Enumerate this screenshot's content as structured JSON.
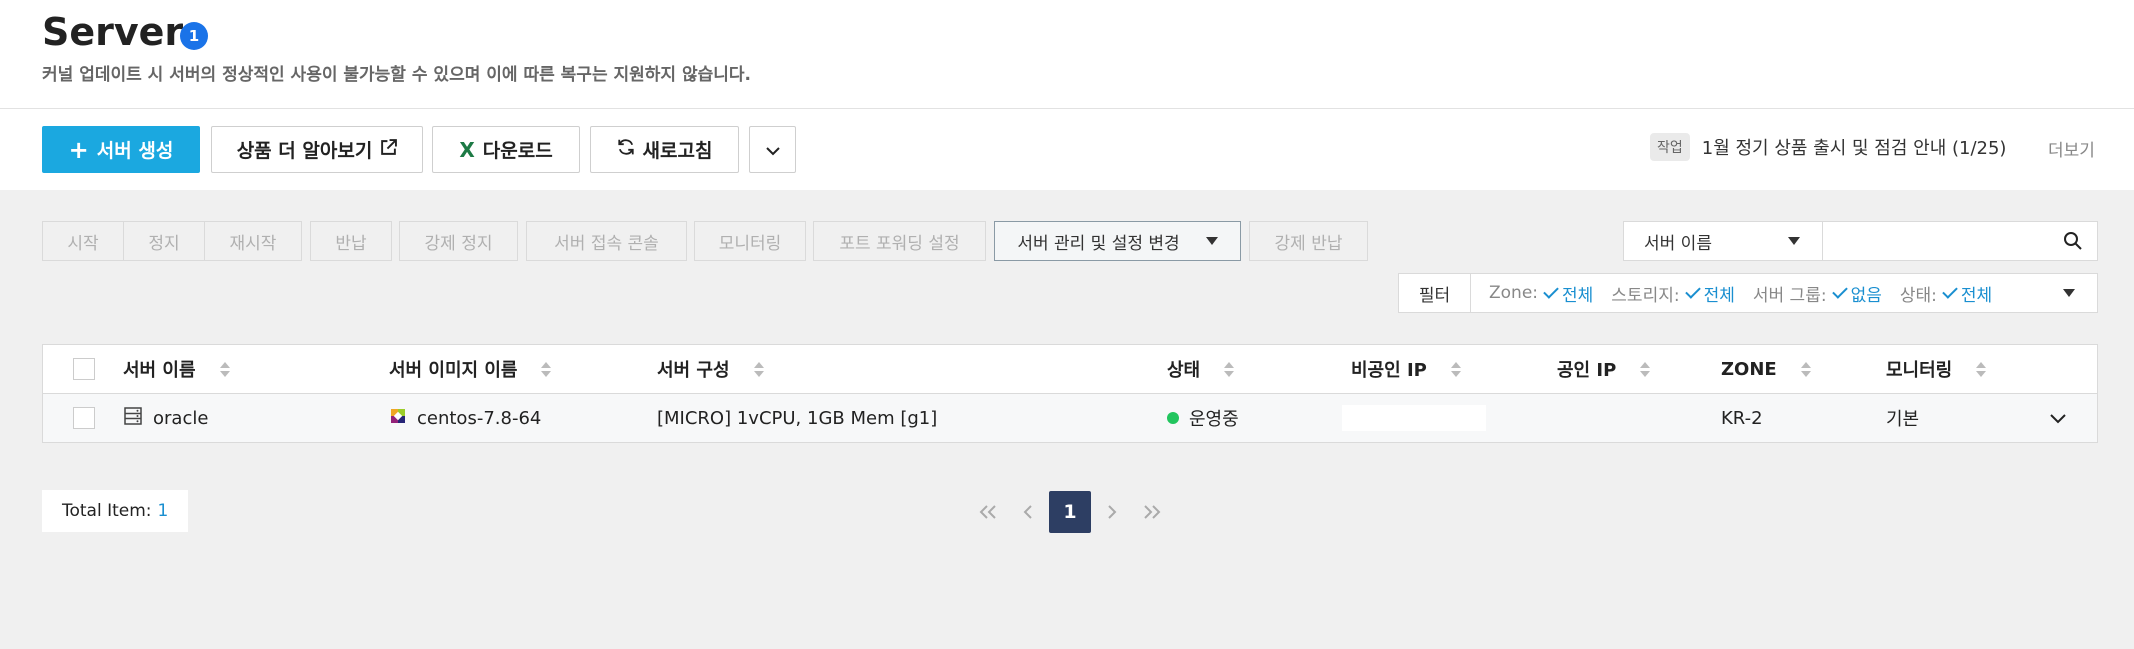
{
  "header": {
    "title": "Server",
    "count": "1",
    "subtitle": "커널 업데이트 시 서버의 정상적인 사용이 불가능할 수 있으며 이에 따른 복구는 지원하지 않습니다."
  },
  "toolbar": {
    "create": "서버 생성",
    "learn_more": "상품 더 알아보기",
    "download": "다운로드",
    "refresh": "새로고침"
  },
  "notice": {
    "tag": "작업",
    "text": "1월 정기 상품 출시 및 점검 안내 (1/25)",
    "more": "더보기"
  },
  "actions": {
    "start": "시작",
    "stop": "정지",
    "restart": "재시작",
    "return": "반납",
    "force_stop": "강제 정지",
    "console": "서버 접속 콘솔",
    "monitoring": "모니터링",
    "port_forward": "포트 포워딩 설정",
    "manage": "서버 관리 및 설정 변경",
    "force_return": "강제 반납"
  },
  "search": {
    "field": "서버 이름",
    "value": ""
  },
  "filter": {
    "label": "필터",
    "zone_label": "Zone:",
    "zone_value": "전체",
    "storage_label": "스토리지:",
    "storage_value": "전체",
    "group_label": "서버 그룹:",
    "group_value": "없음",
    "status_label": "상태:",
    "status_value": "전체"
  },
  "table": {
    "columns": {
      "name": "서버 이름",
      "image": "서버 이미지 이름",
      "spec": "서버 구성",
      "status": "상태",
      "private_ip": "비공인 IP",
      "public_ip": "공인 IP",
      "zone": "ZONE",
      "monitoring": "모니터링"
    },
    "rows": [
      {
        "name": "oracle",
        "image": "centos-7.8-64",
        "spec": "[MICRO] 1vCPU, 1GB Mem [g1]",
        "status": "운영중",
        "private_ip": "",
        "public_ip": "",
        "zone": "KR-2",
        "monitoring": "기본"
      }
    ]
  },
  "footer": {
    "total_label": "Total Item:",
    "total_value": "1",
    "current_page": "1"
  },
  "colors": {
    "primary": "#1ba8e0",
    "link": "#1a8fd0",
    "status_running": "#22c55e",
    "page_active": "#2d3e63",
    "excel": "#1d7a45"
  }
}
